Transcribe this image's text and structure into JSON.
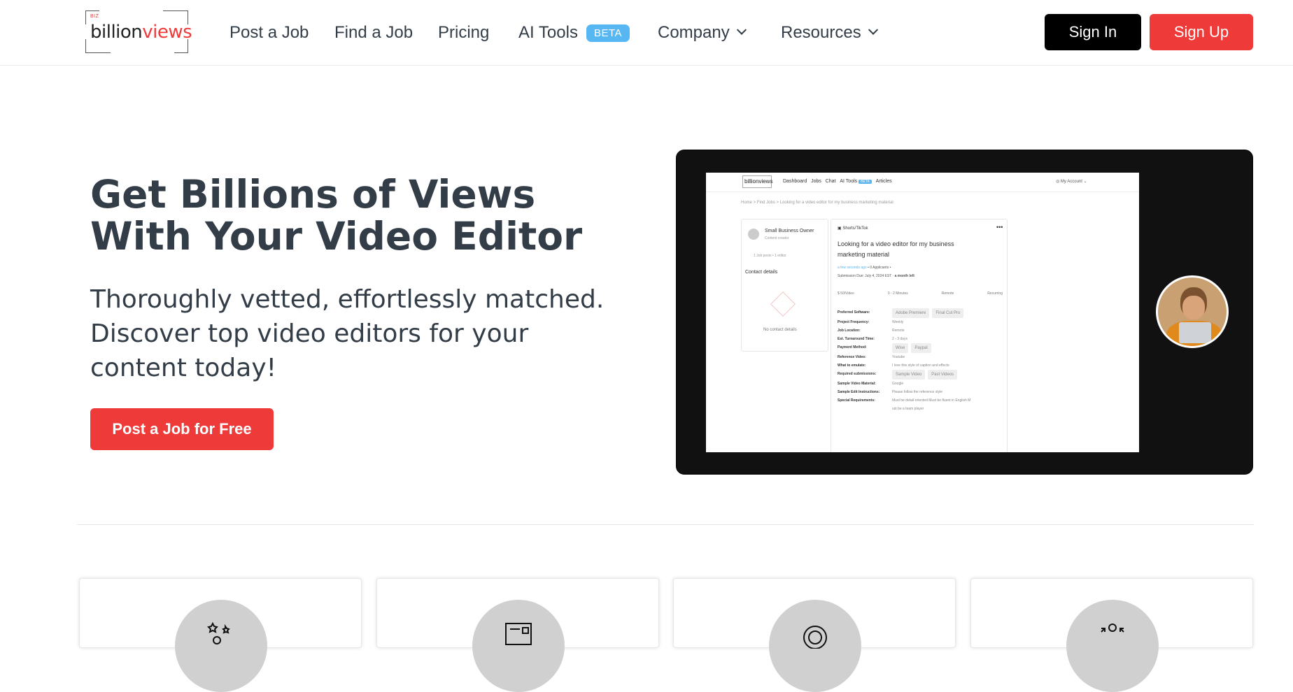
{
  "header": {
    "logo": {
      "tag": "BIZ",
      "word_a": "billion",
      "word_b": "views"
    },
    "nav": [
      {
        "label": "Post a Job"
      },
      {
        "label": "Find a Job"
      },
      {
        "label": "Pricing"
      },
      {
        "label": "AI Tools",
        "badge": "BETA"
      },
      {
        "label": "Company"
      },
      {
        "label": "Resources"
      }
    ],
    "sign_in": "Sign In",
    "sign_up": "Sign Up"
  },
  "hero": {
    "title_line1": "Get Billions of Views",
    "title_line2": "With Your Video Editor",
    "subtitle": "Thoroughly vetted, effortlessly matched. Discover top video editors for your content today!",
    "cta": "Post a Job for Free"
  },
  "preview": {
    "logo": "billionviews",
    "nav": [
      "Dashboard",
      "Jobs",
      "Chat",
      "AI Tools",
      "Articles"
    ],
    "account": "My Account",
    "breadcrumb": "Home  >  Find Jobs  >  Looking for a video editor for my business marketing material",
    "owner": "Small Business Owner",
    "owner_role": "Content creator",
    "owner_stats": "1 Job posts  •  1 editor",
    "contact_details": "Contact details",
    "no_contact": "No contact details",
    "platform": "Shorts/TikTok",
    "job_title_1": "Looking for a video editor for my business",
    "job_title_2": "marketing material",
    "posted": "a few seconds ago",
    "applicants": "0 Applicants",
    "deadline": "Submission Due: July 4, 2024 EST",
    "deadline_left": "a month left",
    "meta": [
      "$ 50/Video",
      "0 - 2 Minutes",
      "Remote",
      "Recurring"
    ],
    "fields": [
      {
        "k": "Preferred Software:",
        "v": [
          "Adobe Premiere",
          "Final Cut Pro"
        ]
      },
      {
        "k": "Project Frequency:",
        "t": "Weekly"
      },
      {
        "k": "Job Location:",
        "t": "Remote"
      },
      {
        "k": "Est. Turnaround Time:",
        "t": "2 - 3 days"
      },
      {
        "k": "Payment Method:",
        "v": [
          "Wise",
          "Paypal"
        ]
      },
      {
        "k": "Reference Video:",
        "t": "Youtube"
      },
      {
        "k": "What to emulate:",
        "t": "I love this style of caption and effects"
      },
      {
        "k": "Required submissions:",
        "v": [
          "Sample Video",
          "Past Videos"
        ]
      },
      {
        "k": "Sample Video Material:",
        "t": "Google"
      },
      {
        "k": "Sample Edit Instructions:",
        "t": "Please follow the reference style"
      },
      {
        "k": "Special Requirements:",
        "t": "Must be detail-oriented   Must be fluent in English   M"
      },
      {
        "k": "",
        "t": "ust be a team player"
      }
    ]
  },
  "colors": {
    "accent": "#ef3a3a",
    "badge": "#56b7f2",
    "text": "#333d47"
  },
  "cards": [
    {
      "icon": "stars-user-icon"
    },
    {
      "icon": "newspaper-icon"
    },
    {
      "icon": "target-icon"
    },
    {
      "icon": "network-user-icon"
    }
  ]
}
